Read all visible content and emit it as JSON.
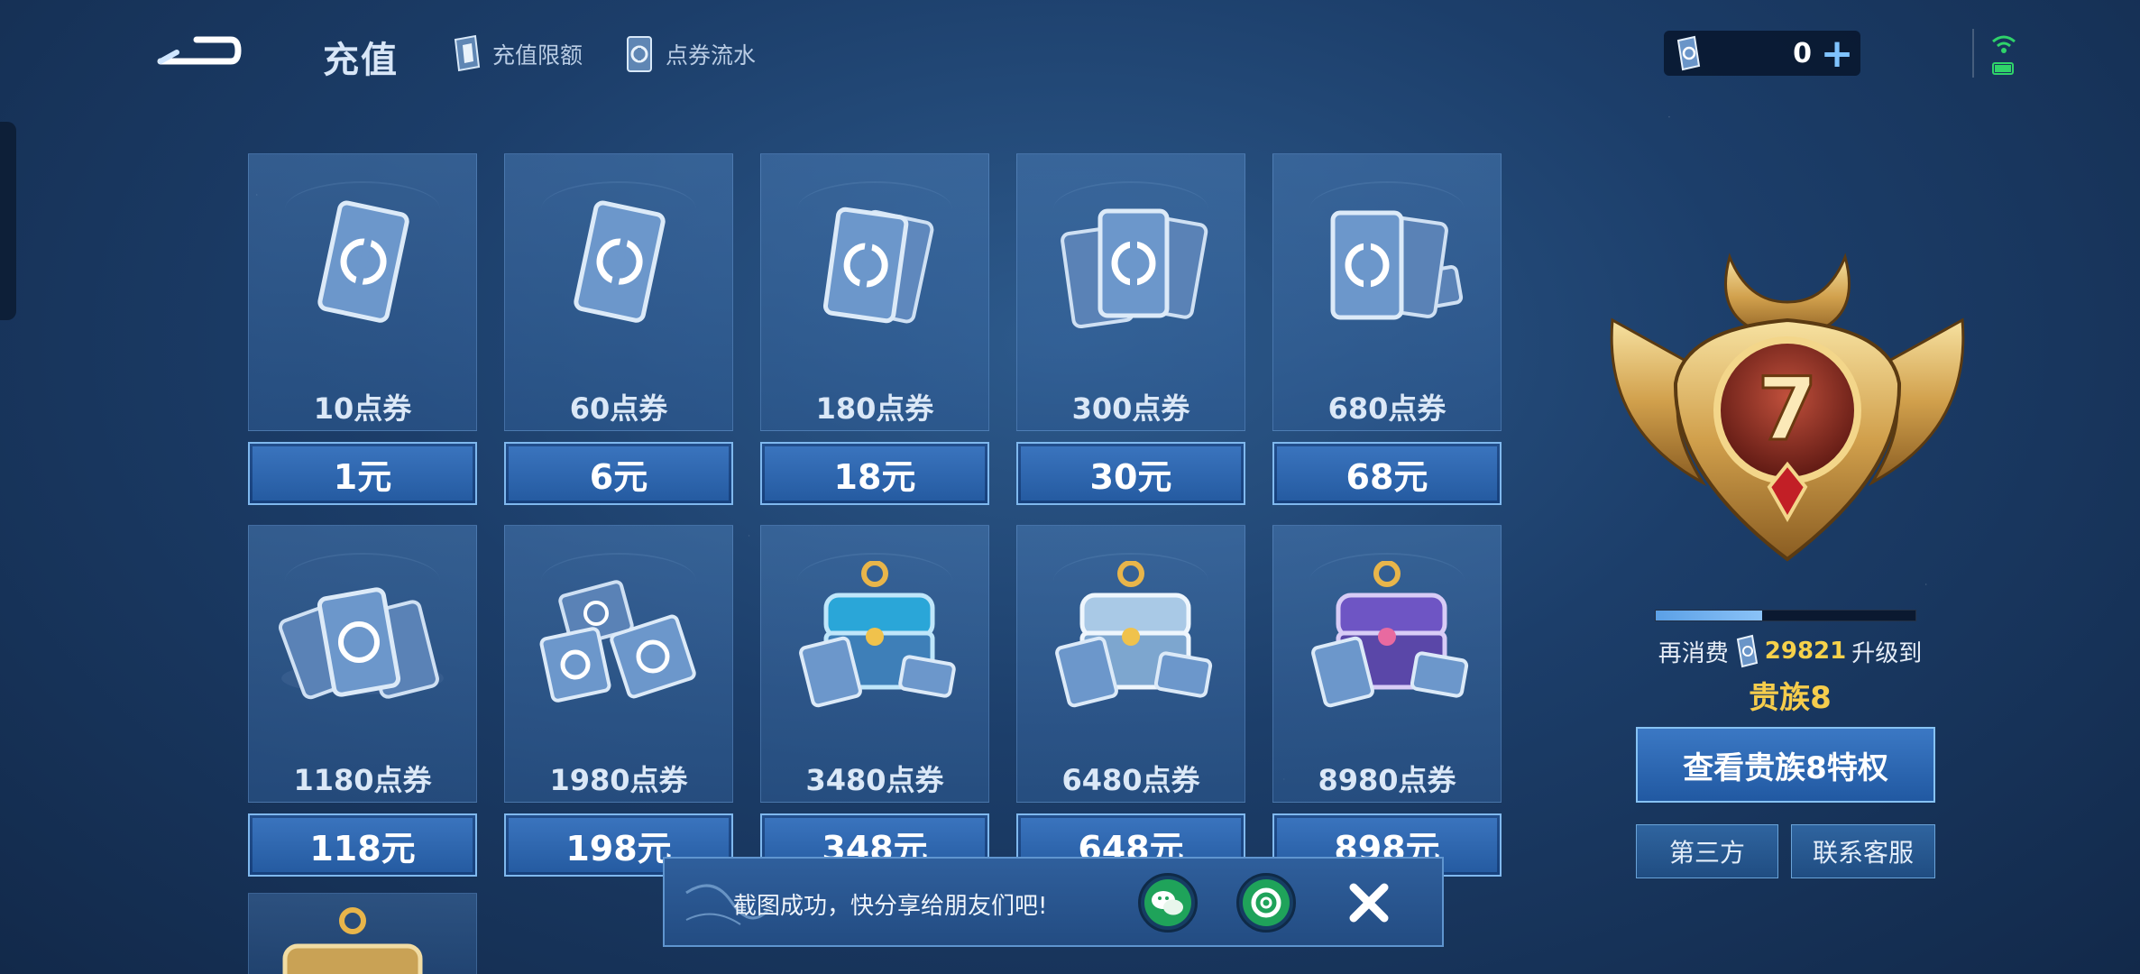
{
  "header": {
    "title": "充值",
    "links": [
      {
        "label": "充值限额",
        "icon": "card-icon"
      },
      {
        "label": "点券流水",
        "icon": "flow-icon"
      }
    ],
    "coin_balance": "0",
    "plus_label": "+"
  },
  "products": [
    {
      "qty": "10点券",
      "price": "1元",
      "art": "single-card"
    },
    {
      "qty": "60点券",
      "price": "6元",
      "art": "single-card"
    },
    {
      "qty": "180点券",
      "price": "18元",
      "art": "double-card"
    },
    {
      "qty": "300点券",
      "price": "30元",
      "art": "triple-card"
    },
    {
      "qty": "680点券",
      "price": "68元",
      "art": "card-stack"
    },
    {
      "qty": "1180点券",
      "price": "118元",
      "art": "card-pile"
    },
    {
      "qty": "1980点券",
      "price": "198元",
      "art": "card-heap"
    },
    {
      "qty": "3480点券",
      "price": "348元",
      "art": "chest-blue"
    },
    {
      "qty": "6480点券",
      "price": "648元",
      "art": "chest-silver"
    },
    {
      "qty": "8980点券",
      "price": "898元",
      "art": "chest-purple"
    }
  ],
  "noble": {
    "level_badge": "7",
    "progress": 0.41,
    "prefix": "再消费",
    "amount": "29821",
    "suffix": "升级到",
    "next_level": "贵族8",
    "privilege_button": "查看贵族8特权",
    "third_party": "第三方",
    "support": "联系客服"
  },
  "toast": {
    "message": "截图成功，快分享给朋友们吧!"
  },
  "colors": {
    "accent_gold": "#f6cd4c",
    "button_blue": "#2a64ab",
    "wechat_green": "#1fa35a"
  }
}
